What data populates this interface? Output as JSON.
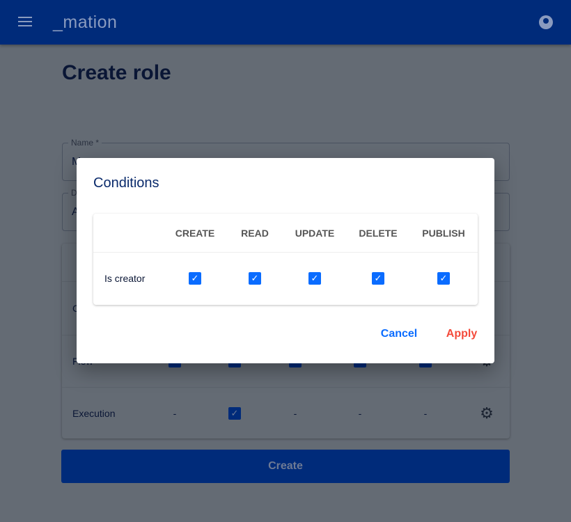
{
  "header": {
    "logo": "_mation",
    "menu_icon": "hamburger-icon",
    "account_icon": "account-circle-icon"
  },
  "page": {
    "title": "Create role",
    "name_field": {
      "label": "Name *",
      "value": "M"
    },
    "desc_field": {
      "label": "D",
      "value": "A"
    },
    "rows": [
      {
        "name": "C"
      },
      {
        "name": "Flow"
      },
      {
        "name": "Execution",
        "cells": [
          "-",
          "checked",
          "-",
          "-",
          "-"
        ]
      }
    ],
    "create_label": "Create"
  },
  "modal": {
    "title": "Conditions",
    "columns": [
      "CREATE",
      "READ",
      "UPDATE",
      "DELETE",
      "PUBLISH"
    ],
    "rows": [
      {
        "name": "Is creator",
        "values": [
          true,
          true,
          true,
          true,
          true
        ]
      }
    ],
    "cancel_label": "Cancel",
    "apply_label": "Apply"
  },
  "colors": {
    "brand": "#002b7a",
    "checkbox": "#0a6cff",
    "cancel": "#0a6cff",
    "apply": "#f44a3a"
  }
}
